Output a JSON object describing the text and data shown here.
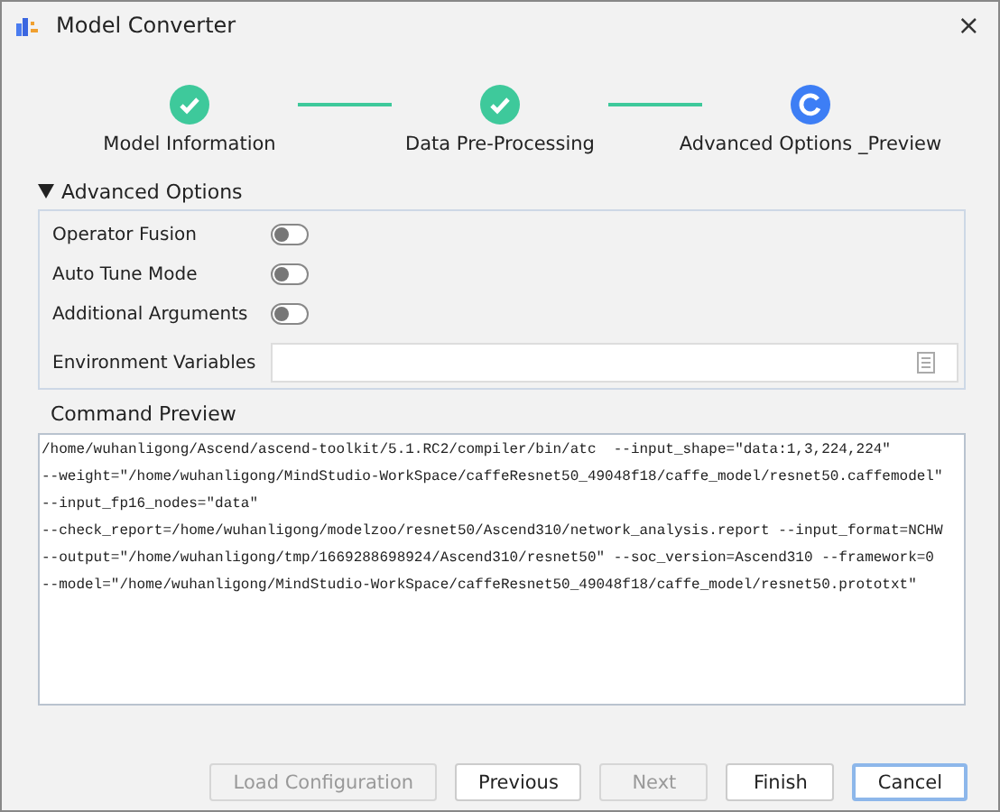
{
  "window": {
    "title": "Model Converter",
    "close": "×"
  },
  "steps": [
    {
      "label": "Model Information",
      "completed": true
    },
    {
      "label": "Data Pre-Processing",
      "completed": true
    },
    {
      "label": "Advanced Options _Preview",
      "completed": false
    }
  ],
  "advanced": {
    "title": "Advanced Options",
    "expanded": true,
    "toggles": [
      {
        "label": "Operator Fusion",
        "on": false
      },
      {
        "label": "Auto Tune Mode",
        "on": false
      },
      {
        "label": "Additional Arguments",
        "on": false
      }
    ],
    "env_field": {
      "label": "Environment Variables"
    }
  },
  "command_preview": {
    "title": "Command Preview",
    "text": "/home/wuhanligong/Ascend/ascend-toolkit/5.1.RC2/compiler/bin/atc  --input_shape=\"data:1,3,224,224\"\n--weight=\"/home/wuhanligong/MindStudio-WorkSpace/caffeResnet50_49048f18/caffe_model/resnet50.caffemodel\"\n--input_fp16_nodes=\"data\"\n--check_report=/home/wuhanligong/modelzoo/resnet50/Ascend310/network_analysis.report --input_format=NCHW\n--output=\"/home/wuhanligong/tmp/1669288698924/Ascend310/resnet50\" --soc_version=Ascend310 --framework=0\n--model=\"/home/wuhanligong/MindStudio-WorkSpace/caffeResnet50_49048f18/caffe_model/resnet50.prototxt\""
  },
  "buttons": [
    {
      "label": "Load Configuration",
      "disabled": true,
      "focused": false
    },
    {
      "label": "Previous",
      "disabled": false,
      "focused": false
    },
    {
      "label": "Next",
      "disabled": true,
      "focused": false
    },
    {
      "label": "Finish",
      "disabled": false,
      "focused": false
    },
    {
      "label": "Cancel",
      "disabled": false,
      "focused": true
    }
  ]
}
